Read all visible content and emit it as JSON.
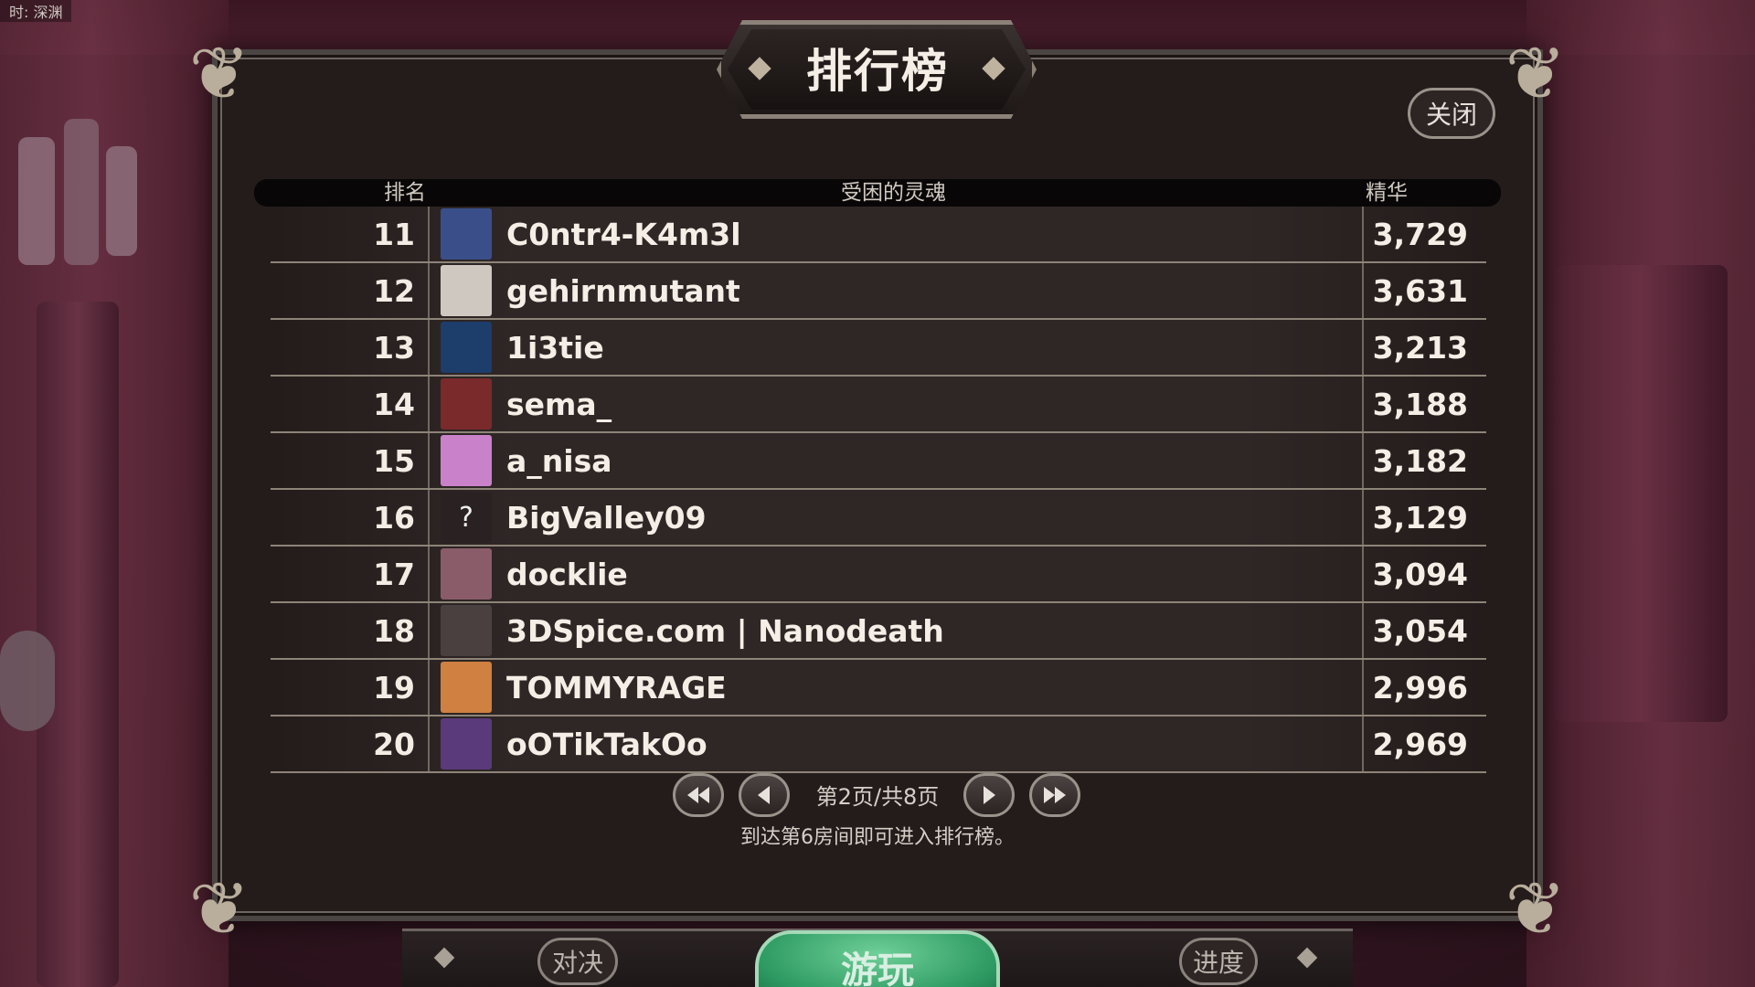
{
  "top_label": "时: 深渊",
  "title": "排行榜",
  "close_label": "关闭",
  "table": {
    "headers": {
      "rank": "排名",
      "name": "受困的灵魂",
      "score": "精华"
    },
    "rows": [
      {
        "rank": "11",
        "name": "C0ntr4-K4m3l",
        "score": "3,729",
        "avatar": "wizard-avatar-icon",
        "color": "#3a4f8a"
      },
      {
        "rank": "12",
        "name": "gehirnmutant",
        "score": "3,631",
        "avatar": "man-avatar-icon",
        "color": "#cfc8c1"
      },
      {
        "rank": "13",
        "name": "1i3tie",
        "score": "3,213",
        "avatar": "logo-avatar-icon",
        "color": "#1d3d6b"
      },
      {
        "rank": "14",
        "name": "sema_",
        "score": "3,188",
        "avatar": "woman-avatar-icon",
        "color": "#7a2a2a"
      },
      {
        "rank": "15",
        "name": "a_nisa",
        "score": "3,182",
        "avatar": "anime-avatar-icon",
        "color": "#c982c9"
      },
      {
        "rank": "16",
        "name": "BigValley09",
        "score": "3,129",
        "avatar": "unknown-avatar-icon",
        "color": "#2a2222"
      },
      {
        "rank": "17",
        "name": "docklie",
        "score": "3,094",
        "avatar": "portal-avatar-icon",
        "color": "#8a5c6a"
      },
      {
        "rank": "18",
        "name": "3DSpice.com | Nanodeath",
        "score": "3,054",
        "avatar": "girl-avatar-icon",
        "color": "#4a4040"
      },
      {
        "rank": "19",
        "name": "TOMMYRAGE",
        "score": "2,996",
        "avatar": "face-avatar-icon",
        "color": "#d08040"
      },
      {
        "rank": "20",
        "name": "oOTikTakOo",
        "score": "2,969",
        "avatar": "character-avatar-icon",
        "color": "#5a3a7a"
      }
    ]
  },
  "pager": {
    "text": "第2页/共8页"
  },
  "hint": "到达第6房间即可进入排行榜。",
  "bottom_nav": {
    "duel": "对决",
    "play": "游玩",
    "progress": "进度"
  }
}
